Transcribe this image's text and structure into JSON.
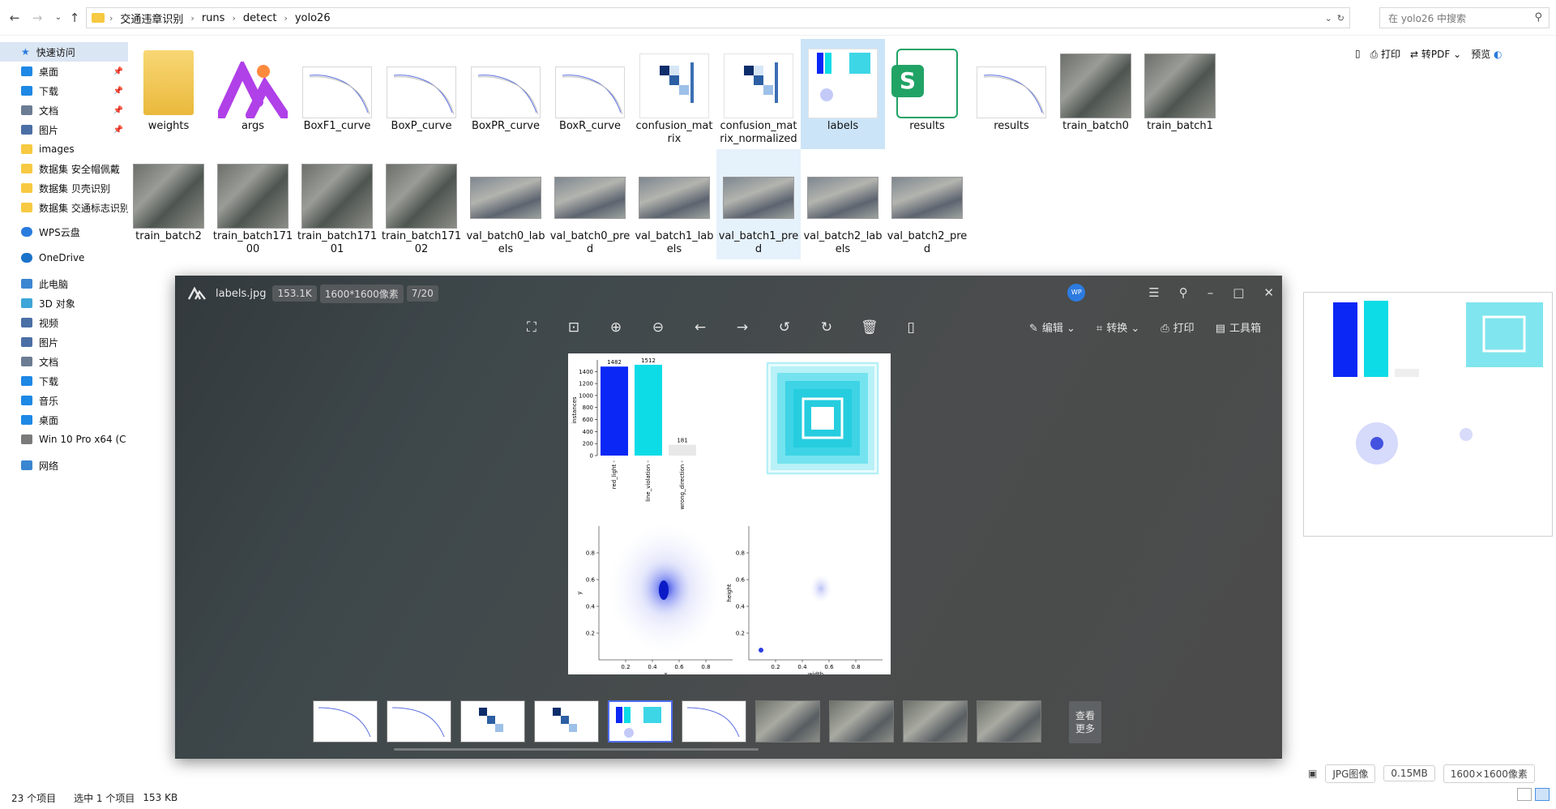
{
  "explorer": {
    "breadcrumb": [
      "交通违章识别",
      "runs",
      "detect",
      "yolo26"
    ],
    "search_placeholder": "在 yolo26 中搜索",
    "nav": {
      "quick_access": "快速访问",
      "items": [
        {
          "label": "桌面",
          "icon": "desktop-icon",
          "color": "#1e88e5",
          "pinned": true
        },
        {
          "label": "下载",
          "icon": "download-icon",
          "color": "#1e88e5",
          "pinned": true
        },
        {
          "label": "文档",
          "icon": "document-icon",
          "color": "#6b7c93",
          "pinned": true
        },
        {
          "label": "图片",
          "icon": "picture-icon",
          "color": "#4a6fa5",
          "pinned": true
        },
        {
          "label": "images",
          "icon": "folder-icon",
          "color": "#f7c942",
          "pinned": false
        },
        {
          "label": "数据集 安全帽佩戴",
          "icon": "folder-icon",
          "color": "#f7c942",
          "pinned": false
        },
        {
          "label": "数据集 贝壳识别",
          "icon": "folder-icon",
          "color": "#f7c942",
          "pinned": false
        },
        {
          "label": "数据集 交通标志识别",
          "icon": "folder-icon",
          "color": "#f7c942",
          "pinned": false
        }
      ],
      "wps": "WPS云盘",
      "onedrive": "OneDrive",
      "this_pc": "此电脑",
      "pc_items": [
        {
          "label": "3D 对象",
          "icon": "cube-icon",
          "color": "#3ea6d8"
        },
        {
          "label": "视频",
          "icon": "video-icon",
          "color": "#4a6fa5"
        },
        {
          "label": "图片",
          "icon": "picture-icon",
          "color": "#4a6fa5"
        },
        {
          "label": "文档",
          "icon": "document-icon",
          "color": "#6b7c93"
        },
        {
          "label": "下载",
          "icon": "download-icon",
          "color": "#1e88e5"
        },
        {
          "label": "音乐",
          "icon": "music-icon",
          "color": "#1e88e5"
        },
        {
          "label": "桌面",
          "icon": "desktop-icon",
          "color": "#1e88e5"
        },
        {
          "label": "Win 10 Pro x64 (C",
          "icon": "drive-icon",
          "color": "#7a7a7a"
        }
      ],
      "network": "网络"
    },
    "files_row1": [
      {
        "name": "weights",
        "kind": "folder"
      },
      {
        "name": "args",
        "kind": "app"
      },
      {
        "name": "BoxF1_curve",
        "kind": "curve"
      },
      {
        "name": "BoxP_curve",
        "kind": "curve"
      },
      {
        "name": "BoxPR_curve",
        "kind": "curve"
      },
      {
        "name": "BoxR_curve",
        "kind": "curve"
      },
      {
        "name": "confusion_matrix",
        "kind": "cm"
      },
      {
        "name": "confusion_matrix_normalized",
        "kind": "cm"
      },
      {
        "name": "labels",
        "kind": "labels",
        "selected": true
      },
      {
        "name": "results",
        "kind": "sheet"
      },
      {
        "name": "results",
        "kind": "curve"
      },
      {
        "name": "train_batch0",
        "kind": "photo"
      },
      {
        "name": "train_batch1",
        "kind": "photo"
      }
    ],
    "files_row2": [
      {
        "name": "train_batch2",
        "kind": "photo"
      },
      {
        "name": "train_batch17100",
        "kind": "photo"
      },
      {
        "name": "train_batch17101",
        "kind": "photo"
      },
      {
        "name": "train_batch17102",
        "kind": "photo"
      },
      {
        "name": "val_batch0_labels",
        "kind": "wide"
      },
      {
        "name": "val_batch0_pred",
        "kind": "wide"
      },
      {
        "name": "val_batch1_labels",
        "kind": "wide"
      },
      {
        "name": "val_batch1_pred",
        "kind": "wide",
        "hover": true
      },
      {
        "name": "val_batch2_labels",
        "kind": "wide"
      },
      {
        "name": "val_batch2_pred",
        "kind": "wide"
      }
    ],
    "status": {
      "count": "23 个项目",
      "selected": "选中 1 个项目",
      "size": "153 KB"
    },
    "preview_toolbar": {
      "print": "打印",
      "to_pdf": "转PDF",
      "preview": "预览"
    },
    "preview_footer": {
      "type": "JPG图像",
      "size": "0.15MB",
      "dims": "1600×1600像素"
    }
  },
  "viewer": {
    "filename": "labels.jpg",
    "filesize": "153.1K",
    "dims": "1600*1600像素",
    "index": "7/20",
    "avatar": "WP",
    "edit": "编辑",
    "convert": "转换",
    "print": "打印",
    "toolbox": "工具箱",
    "more": "查看更多",
    "accent": "#4e6df2"
  },
  "chart_data": {
    "type": "bar",
    "categories": [
      "red_light",
      "line_violation",
      "wrong_direction"
    ],
    "values": [
      1482,
      1512,
      181
    ],
    "ylabel": "instances",
    "yticks": [
      0,
      200,
      400,
      600,
      800,
      1000,
      1200,
      1400
    ],
    "colors": [
      "#0a27f5",
      "#0ddce6",
      "#e8e8e8"
    ],
    "scatter_xy": {
      "xlabel": "x",
      "ylabel": "y",
      "xticks": [
        0.2,
        0.4,
        0.6,
        0.8
      ],
      "yticks": [
        0.2,
        0.4,
        0.6,
        0.8
      ]
    },
    "scatter_wh": {
      "xlabel": "width",
      "ylabel": "height",
      "xticks": [
        0.2,
        0.4,
        0.6,
        0.8
      ],
      "yticks": [
        0.2,
        0.4,
        0.6,
        0.8
      ]
    }
  }
}
